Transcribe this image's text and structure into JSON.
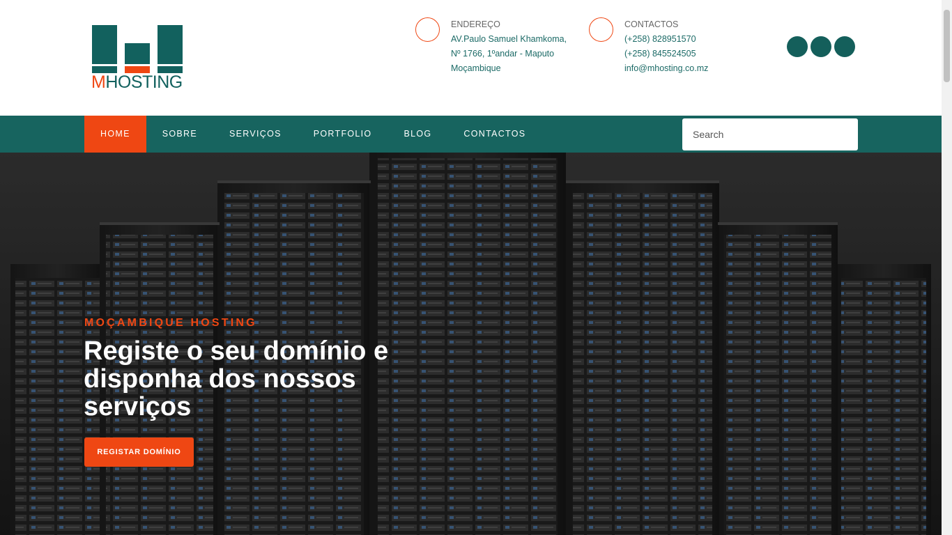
{
  "brand": {
    "logo_letter": "M",
    "logo_rest": "HOSTING",
    "primary_color": "#17645f",
    "accent_color": "#ef4713"
  },
  "header": {
    "address": {
      "title": "ENDEREÇO",
      "lines": [
        "AV.Paulo Samuel Khamkoma,",
        "Nº 1766, 1ºandar - Maputo",
        "Moçambique"
      ]
    },
    "contacts": {
      "title": "CONTACTOS",
      "lines": [
        "(+258) 828951570",
        "(+258) 845524505",
        "info@mhosting.co.mz"
      ]
    },
    "social_icons": [
      "social-icon-1",
      "social-icon-2",
      "social-icon-3"
    ]
  },
  "nav": {
    "items": [
      {
        "label": "HOME",
        "active": true
      },
      {
        "label": "SOBRE"
      },
      {
        "label": "SERVIÇOS"
      },
      {
        "label": "PORTFOLIO"
      },
      {
        "label": "BLOG"
      },
      {
        "label": "CONTACTOS"
      }
    ],
    "search_placeholder": "Search"
  },
  "hero": {
    "kicker": "MOÇAMBIQUE HOSTING",
    "title": "Registe o seu domínio e disponha dos nossos serviços",
    "button_label": "REGISTAR DOMÍNIO"
  }
}
